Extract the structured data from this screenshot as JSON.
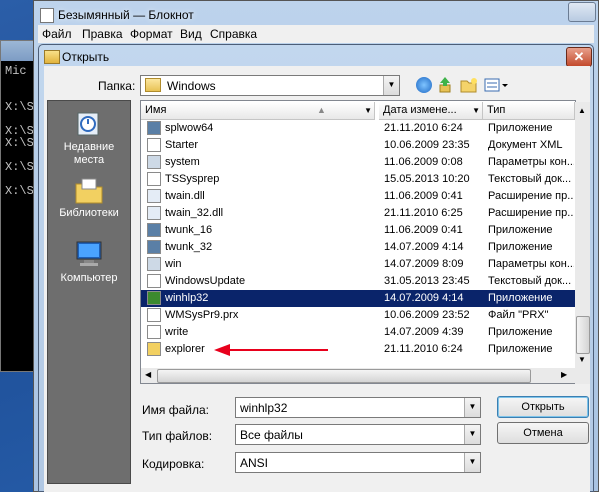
{
  "console": {
    "lines": [
      "Mic",
      "",
      "X:\\S",
      "",
      "X:\\S",
      "X:\\S",
      "",
      "X:\\S",
      "",
      "X:\\S"
    ]
  },
  "notepad": {
    "title": "Безымянный — Блокнот",
    "menu": [
      "Файл",
      "Правка",
      "Формат",
      "Вид",
      "Справка"
    ]
  },
  "dialog": {
    "title": "Открыть",
    "close_glyph": "✕",
    "folder_label": "Папка:",
    "folder_value": "Windows",
    "places": [
      {
        "label": "Недавние\nместа",
        "icon": "recent-places-icon"
      },
      {
        "label": "Библиотеки",
        "icon": "libraries-icon"
      },
      {
        "label": "Компьютер",
        "icon": "computer-icon"
      }
    ],
    "columns": {
      "name": "Имя",
      "date": "Дата измене...",
      "type": "Тип"
    },
    "files": [
      {
        "name": "splwow64",
        "date": "21.11.2010 6:24",
        "type": "Приложение",
        "icon": "app-icon"
      },
      {
        "name": "Starter",
        "date": "10.06.2009 23:35",
        "type": "Документ XML",
        "icon": "xml-icon"
      },
      {
        "name": "system",
        "date": "11.06.2009 0:08",
        "type": "Параметры кон...",
        "icon": "settings-file-icon"
      },
      {
        "name": "TSSysprep",
        "date": "15.05.2013 10:20",
        "type": "Текстовый док...",
        "icon": "text-file-icon"
      },
      {
        "name": "twain.dll",
        "date": "11.06.2009 0:41",
        "type": "Расширение пр...",
        "icon": "dll-icon"
      },
      {
        "name": "twain_32.dll",
        "date": "21.11.2010 6:25",
        "type": "Расширение пр...",
        "icon": "dll-icon"
      },
      {
        "name": "twunk_16",
        "date": "11.06.2009 0:41",
        "type": "Приложение",
        "icon": "app-icon"
      },
      {
        "name": "twunk_32",
        "date": "14.07.2009 4:14",
        "type": "Приложение",
        "icon": "app-icon"
      },
      {
        "name": "win",
        "date": "14.07.2009 8:09",
        "type": "Параметры кон...",
        "icon": "settings-file-icon"
      },
      {
        "name": "WindowsUpdate",
        "date": "31.05.2013 23:45",
        "type": "Текстовый док...",
        "icon": "text-file-icon"
      },
      {
        "name": "winhlp32",
        "date": "14.07.2009 4:14",
        "type": "Приложение",
        "icon": "help-app-icon",
        "selected": true
      },
      {
        "name": "WMSysPr9.prx",
        "date": "10.06.2009 23:52",
        "type": "Файл \"PRX\"",
        "icon": "prx-file-icon"
      },
      {
        "name": "write",
        "date": "14.07.2009 4:39",
        "type": "Приложение",
        "icon": "write-app-icon"
      },
      {
        "name": "explorer",
        "date": "21.11.2010 6:24",
        "type": "Приложение",
        "icon": "explorer-icon"
      }
    ],
    "filename_label": "Имя файла:",
    "filename_value": "winhlp32",
    "filetype_label": "Тип файлов:",
    "filetype_value": "Все файлы",
    "encoding_label": "Кодировка:",
    "encoding_value": "ANSI",
    "open_button": "Открыть",
    "cancel_button": "Отмена"
  },
  "colors": {
    "selection": "#0a246a",
    "arrow": "#e8001c"
  }
}
